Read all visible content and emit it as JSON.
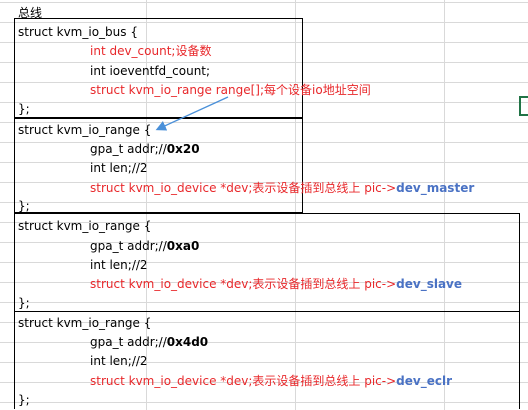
{
  "sheet": {
    "header": "总线",
    "bus_block": {
      "open": "struct kvm_io_bus {",
      "dev_count": "int dev_count;设备数",
      "ioeventfd_count": "int ioeventfd_count;",
      "range": "struct kvm_io_range range[];每个设备io地址空间",
      "close": "};"
    },
    "ranges": [
      {
        "open": "struct kvm_io_range {",
        "addr_prefix": "gpa_t addr;//",
        "addr_value": "0x20",
        "len": "int len;//2",
        "dev_prefix": "struct kvm_io_device *dev;表示设备插到总线上 pic->",
        "dev_name": "dev_master",
        "close": "};"
      },
      {
        "open": "struct kvm_io_range {",
        "addr_prefix": "gpa_t addr;//",
        "addr_value": "0xa0",
        "len": "int len;//2",
        "dev_prefix": "struct kvm_io_device *dev;表示设备插到总线上 pic->",
        "dev_name": "dev_slave",
        "close": "};"
      },
      {
        "open": "struct kvm_io_range {",
        "addr_prefix": "gpa_t addr;//",
        "addr_value": "0x4d0",
        "len": "int len;//2",
        "dev_prefix": "struct kvm_io_device *dev;表示设备插到总线上 pic->",
        "dev_name": "dev_eclr",
        "close": "};"
      }
    ]
  },
  "colors": {
    "red_text": "#e8282b",
    "blue_text": "#4a72c4",
    "arrow": "#4a90d9",
    "grid": "#d9d9d9",
    "selection": "#217346"
  }
}
